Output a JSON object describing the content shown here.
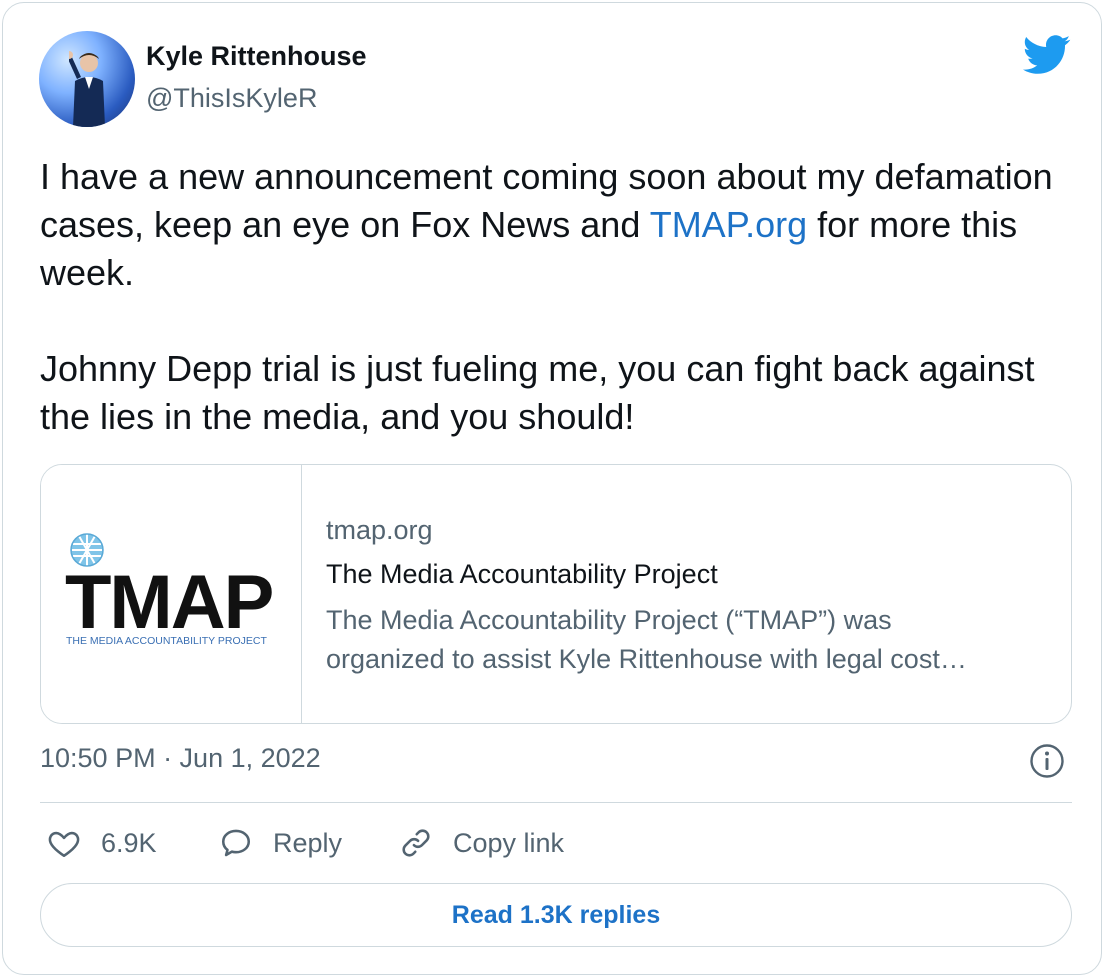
{
  "author": {
    "name": "Kyle Rittenhouse",
    "handle": "@ThisIsKyleR"
  },
  "icons": {
    "platform": "twitter-bird-icon",
    "info": "info-icon",
    "like": "heart-icon",
    "reply": "speech-bubble-icon",
    "copy": "link-icon"
  },
  "colors": {
    "brand": "#1d9bf0",
    "link": "#1d72c7",
    "muted": "#536471",
    "border": "#cfd9de"
  },
  "tweet": {
    "text_line1": "I have a new announcement coming soon about my defamation cases, keep an eye on Fox News and ",
    "link_text": "TMAP.org",
    "text_line1_end": " for more this week.",
    "text_para2": "Johnny Depp trial is just fueling me, you can fight back against the lies in the media, and you should!"
  },
  "link_card": {
    "logo_word": "TMAP",
    "logo_subtitle": "THE MEDIA ACCOUNTABILITY PROJECT",
    "domain": "tmap.org",
    "title": "The Media Accountability Project",
    "description_line1": "The Media Accountability Project (“TMAP”) was",
    "description_line2": "organized to assist Kyle Rittenhouse with legal cost…"
  },
  "timestamp": "10:50 PM · Jun 1, 2022",
  "actions": {
    "like_count": "6.9K",
    "reply_label": "Reply",
    "copy_label": "Copy link"
  },
  "read_replies_label": "Read 1.3K replies"
}
